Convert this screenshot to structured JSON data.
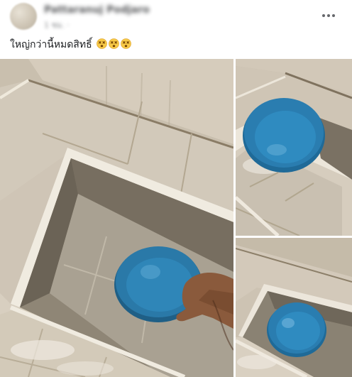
{
  "post": {
    "author_name": "Pattaranuj Podjaro",
    "timestamp": "1 ชม. · ",
    "caption": "ใหญ่กว่านี้หมดสิทธิ์",
    "emojis": [
      "dizzy-face-emoji",
      "dizzy-face-emoji",
      "dizzy-face-emoji"
    ],
    "more_icon": "more-horizontal-icon"
  },
  "photos": [
    {
      "name": "photo-main",
      "subject": "blue-bowl-in-tiled-step-recess"
    },
    {
      "name": "photo-top-right",
      "subject": "blue-bowl-in-tiled-step-recess"
    },
    {
      "name": "photo-bottom-right",
      "subject": "blue-bowl-in-tiled-step-recess"
    }
  ],
  "colors": {
    "bowl": "#2a79a8",
    "tile": "#d4cbbd",
    "grout": "#9c8e78",
    "text": "#1c1e21",
    "secondary": "#65676b"
  }
}
